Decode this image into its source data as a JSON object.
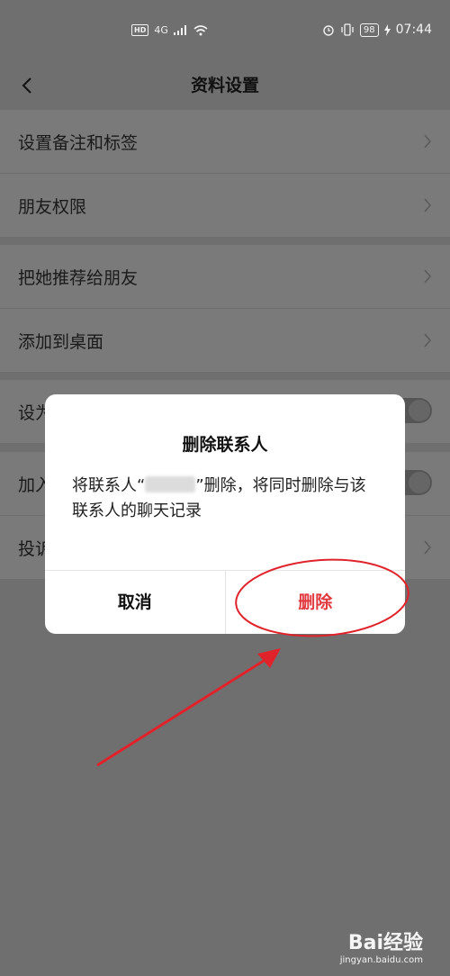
{
  "status_bar": {
    "hd": "HD",
    "network": "4G",
    "battery": "98",
    "time": "07:44"
  },
  "header": {
    "title": "资料设置",
    "back_icon": "chevron-left-icon"
  },
  "settings_groups": [
    {
      "items": [
        {
          "label": "设置备注和标签",
          "control": "chevron"
        },
        {
          "label": "朋友权限",
          "control": "chevron"
        }
      ]
    },
    {
      "items": [
        {
          "label": "把她推荐给朋友",
          "control": "chevron"
        },
        {
          "label": "添加到桌面",
          "control": "chevron"
        }
      ]
    },
    {
      "items": [
        {
          "label": "设为星标朋友",
          "control": "toggle"
        }
      ]
    },
    {
      "items": [
        {
          "label": "加入黑名单",
          "control": "toggle"
        },
        {
          "label": "投诉",
          "control": "chevron"
        }
      ]
    }
  ],
  "dialog": {
    "title": "删除联系人",
    "message_prefix": "将联系人“",
    "message_suffix": "”删除，将同时删除与该联系人的聊天记录",
    "cancel_label": "取消",
    "delete_label": "删除"
  },
  "colors": {
    "overlay": "#6f6f6f",
    "danger": "#e0393e",
    "annotation": "#e0232b"
  },
  "watermark": {
    "logo": "Bai经验",
    "url": "jingyan.baidu.com"
  }
}
